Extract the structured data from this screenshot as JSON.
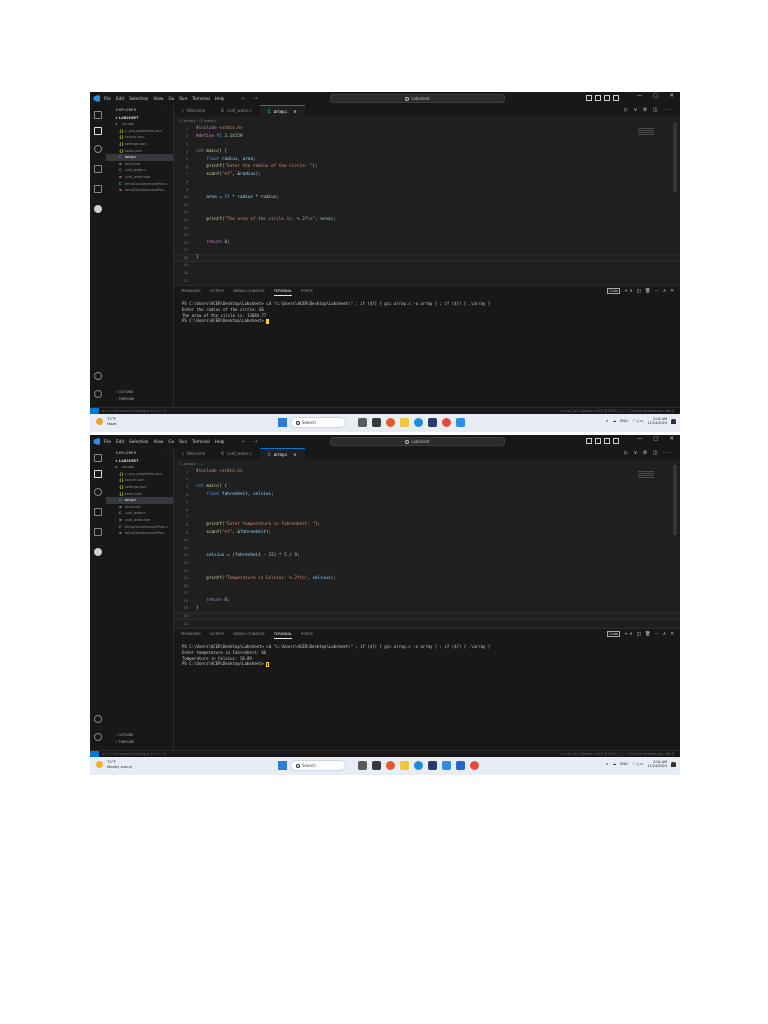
{
  "app": {
    "menu": [
      "File",
      "Edit",
      "Selection",
      "View",
      "Go",
      "Run",
      "Terminal",
      "Help"
    ],
    "nav_arrows": "← →",
    "command_center": "Labsheet",
    "window_controls": [
      "—",
      "▢",
      "✕"
    ]
  },
  "sidebar": {
    "title": "EXPLORER",
    "dots": "···",
    "folder": "∨ LABSHEET",
    "items": [
      {
        "glyph": "∨",
        "label": ".vscode",
        "type": "folder"
      },
      {
        "glyph": "{}",
        "label": "c_cpp_properties.json",
        "type": "json"
      },
      {
        "glyph": "{}",
        "label": "launch.json",
        "type": "json"
      },
      {
        "glyph": "{}",
        "label": "settings.json",
        "type": "json"
      },
      {
        "glyph": "{}",
        "label": "tasks.json",
        "type": "json"
      },
      {
        "glyph": "C",
        "label": "array.c",
        "type": "c",
        "selected": true
      },
      {
        "glyph": "≡",
        "label": "array.exe",
        "type": "exe"
      },
      {
        "glyph": "C",
        "label": "cold_water.c",
        "type": "c"
      },
      {
        "glyph": "≡",
        "label": "cold_water.exe",
        "type": "exe"
      },
      {
        "glyph": "C",
        "label": "tempCalcAdvancedProc.c",
        "type": "c"
      },
      {
        "glyph": "≡",
        "label": "tempCalcAdvancedPro...",
        "type": "exe"
      }
    ],
    "outline": "› OUTLINE",
    "timeline": "› TIMELINE"
  },
  "tabs": [
    {
      "glyph": "⟩",
      "label": "Welcome",
      "kind": "vs"
    },
    {
      "glyph": "C",
      "label": "cold_water.c",
      "kind": "c"
    },
    {
      "glyph": "C",
      "label": "array.c",
      "kind": "c",
      "active": true,
      "close": "✕"
    }
  ],
  "editor_actions": "▷ ∨ ⚙ ◫ ···",
  "panel": {
    "tabs": [
      "PROBLEMS",
      "OUTPUT",
      "DEBUG CONSOLE",
      "TERMINAL",
      "PORTS"
    ],
    "active_tab": "TERMINAL",
    "actions": [
      "Code",
      "+ ∨",
      "◫",
      "🗑",
      "···",
      "∧",
      "✕"
    ]
  },
  "statusbar": {
    "left": "⊗ 0 ⚠ 0   ⚙ Launch   ⚲ Debug   ⊗ 0   ⚠ 0   ☉ 0",
    "right": "Ln 14, Col 2   Spaces: 4   UTF-8   CRLF   { } C   ♫ Go Live   windows-gcc-x64   ⚲"
  },
  "taskbar": {
    "search": "Search",
    "tray_lang": "ENG",
    "tray_time": "2:04 AM",
    "tray_date": "11/24/2024"
  },
  "shots": [
    {
      "breadcrumb": "C array.c › ⓕ main()",
      "lines": [
        "#include <stdio.h>",
        "#define PI 3.14159",
        "",
        "int main() {",
        "    float radius, area;",
        "    printf(\"Enter the radius of the circle: \");",
        "    scanf(\"%f\", &radius);",
        "",
        "",
        "    area = PI * radius * radius;",
        "",
        "",
        "    printf(\"The area of the circle is: %.2f\\n\", area);",
        "",
        "",
        "    return 0;",
        "",
        "}",
        "",
        "",
        "",
        ""
      ],
      "line_numbers": [
        "1",
        "2",
        "3",
        "4",
        "5",
        "6",
        "7",
        "8",
        "9",
        "10",
        "11",
        "12",
        "13",
        "14",
        "15",
        "16",
        "17",
        "18",
        "19",
        "20",
        "21",
        "22"
      ],
      "terminal": [
        "PS C:\\Users\\ACER\\Desktop\\Labsheet> cd \"c:\\Users\\ACER\\Desktop\\Labsheet\\\" ; if ($?) { gcc array.c -o array } ; if ($?) { .\\array }",
        "Enter the radius of the circle: 66",
        "The area of the circle is: 13684.77",
        "PS C:\\Users\\ACER\\Desktop\\Labsheet> "
      ],
      "weather_temp": "72°F",
      "weather_desc": "Haze"
    },
    {
      "breadcrumb": "C array.c › ...",
      "lines": [
        "#include <stdio.h>",
        "",
        "int main() {",
        "    float fahrenheit, celsius;",
        "",
        "",
        "",
        "    printf(\"Enter temperature in Fahrenheit: \");",
        "    scanf(\"%f\", &fahrenheit);",
        "",
        "",
        "    celsius = (fahrenheit - 32) * 5 / 9;",
        "",
        "",
        "    printf(\"Temperature in Celsius: %.2f\\n\", celsius);",
        "",
        "",
        "    return 0;",
        "}",
        "",
        "",
        ""
      ],
      "line_numbers": [
        "1",
        "2",
        "3",
        "4",
        "5",
        "6",
        "7",
        "8",
        "9",
        "10",
        "11",
        "12",
        "13",
        "14",
        "15",
        "16",
        "17",
        "18",
        "19",
        "20",
        "21",
        "22"
      ],
      "terminal": [
        "PS C:\\Users\\ACER\\Desktop\\Labsheet> cd \"c:\\Users\\ACER\\Desktop\\Labsheet\\\" ; if ($?) { gcc array.c -o array } ; if ($?) { .\\array }",
        "Enter temperature in Fahrenheit: 66",
        "Temperature in Celsius: 18.89",
        "PS C:\\Users\\ACER\\Desktop\\Labsheet> "
      ],
      "weather_temp": "72°F",
      "weather_desc": "Mostly sunny"
    }
  ],
  "colors": {
    "keyword": "#569cd6",
    "control": "#c586c0",
    "function": "#dcdcaa",
    "string": "#ce9178",
    "number": "#b5cea8",
    "variable": "#9cdcfe",
    "accent": "#0078d4"
  }
}
